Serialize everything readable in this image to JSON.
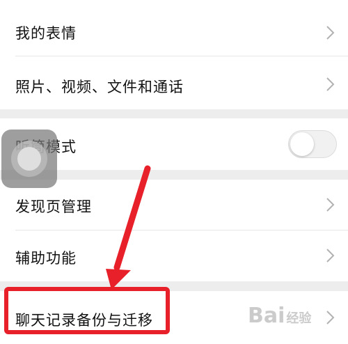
{
  "settings": {
    "items": [
      {
        "label": "我的表情",
        "control": "chevron"
      },
      {
        "label": "照片、视频、文件和通话",
        "control": "chevron"
      },
      {
        "label": "听筒模式",
        "control": "toggle",
        "toggle_on": false
      },
      {
        "label": "发现页管理",
        "control": "chevron"
      },
      {
        "label": "辅助功能",
        "control": "chevron"
      },
      {
        "label": "聊天记录备份与迁移",
        "control": "chevron"
      }
    ]
  },
  "annotation": {
    "highlight_color": "#e8202a",
    "arrow_color": "#e8202a"
  },
  "watermark": {
    "text": "Bai",
    "sub": "经验"
  },
  "colors": {
    "background": "#ededed",
    "row_background": "#ffffff",
    "chevron": "#b2b2b2"
  }
}
